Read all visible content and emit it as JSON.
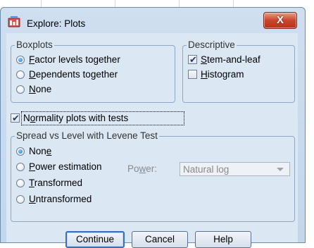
{
  "window": {
    "title": "Explore: Plots",
    "close_glyph": "X"
  },
  "boxplots": {
    "legend": "Boxplots",
    "options": [
      {
        "pre": "",
        "key": "F",
        "post": "actor levels together",
        "selected": true
      },
      {
        "pre": "",
        "key": "D",
        "post": "ependents together",
        "selected": false
      },
      {
        "pre": "",
        "key": "N",
        "post": "one",
        "selected": false
      }
    ]
  },
  "descriptive": {
    "legend": "Descriptive",
    "options": [
      {
        "pre": "",
        "key": "S",
        "post": "tem-and-leaf",
        "checked": true
      },
      {
        "pre": "",
        "key": "H",
        "post": "istogram",
        "checked": false
      }
    ]
  },
  "normality": {
    "pre": "N",
    "key": "o",
    "post": "rmality plots with tests",
    "checked": true
  },
  "spread": {
    "legend": "Spread vs Level with Levene Test",
    "options": [
      {
        "pre": "Non",
        "key": "e",
        "post": "",
        "selected": true
      },
      {
        "pre": "",
        "key": "P",
        "post": "ower estimation",
        "selected": false
      },
      {
        "pre": "",
        "key": "T",
        "post": "ransformed",
        "selected": false
      },
      {
        "pre": "",
        "key": "U",
        "post": "ntransformed",
        "selected": false
      }
    ],
    "power_label": {
      "pre": "Po",
      "key": "w",
      "post": "er:"
    },
    "power_value": "Natural log"
  },
  "buttons": {
    "continue": "Continue",
    "cancel": "Cancel",
    "help": "Help"
  },
  "icons": {
    "app": "spss-app-icon",
    "close": "close-icon"
  }
}
